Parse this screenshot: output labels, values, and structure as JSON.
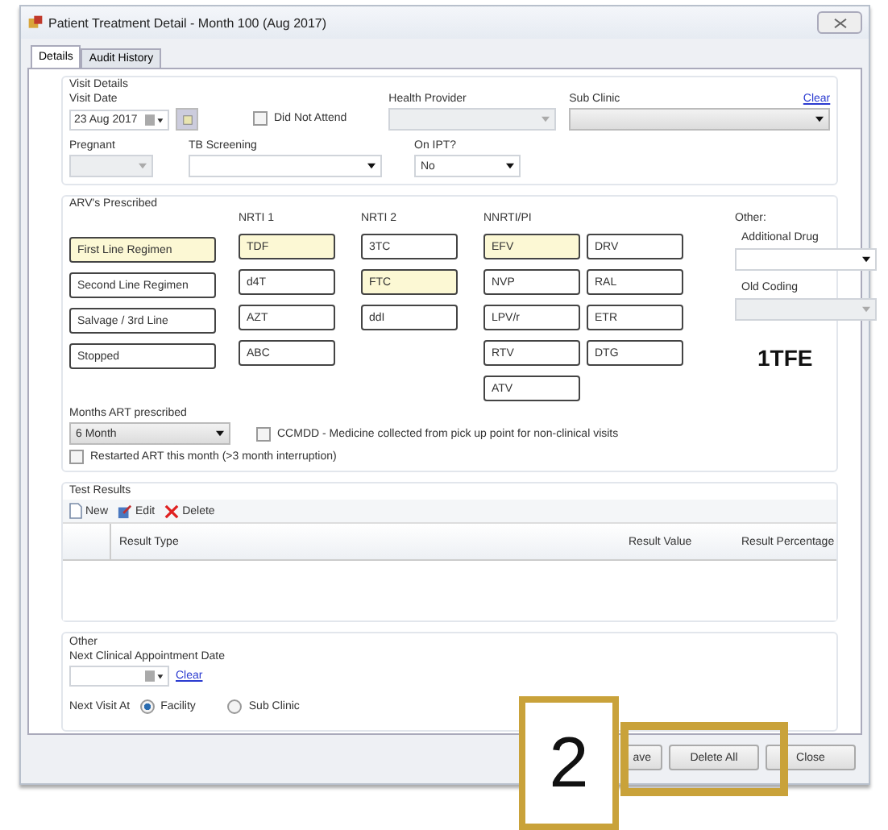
{
  "window": {
    "title": "Patient Treatment Detail - Month  100 (Aug 2017)"
  },
  "tabs": [
    {
      "label": "Details",
      "selected": true
    },
    {
      "label": "Audit History",
      "selected": false
    }
  ],
  "visit_details": {
    "legend": "Visit Details",
    "visit_date": {
      "label": "Visit Date",
      "value": "23 Aug 2017"
    },
    "did_not_attend": {
      "label": "Did Not Attend",
      "checked": false
    },
    "health_provider": {
      "label": "Health Provider",
      "disabled": true
    },
    "sub_clinic": {
      "label": "Sub Clinic",
      "clear": "Clear"
    },
    "pregnant": {
      "label": "Pregnant",
      "disabled": true
    },
    "tb_screening": {
      "label": "TB Screening"
    },
    "on_ipt": {
      "label": "On IPT?",
      "value": "No"
    }
  },
  "arvs": {
    "legend": "ARV's Prescribed",
    "regimens": [
      {
        "label": "First Line Regimen",
        "selected": true
      },
      {
        "label": "Second Line Regimen",
        "selected": false
      },
      {
        "label": "Salvage / 3rd Line",
        "selected": false
      },
      {
        "label": "Stopped",
        "selected": false
      }
    ],
    "groups": [
      {
        "heading": "NRTI 1",
        "columns": [
          [
            {
              "label": "TDF",
              "selected": true
            },
            {
              "label": "d4T",
              "selected": false
            },
            {
              "label": "AZT",
              "selected": false
            },
            {
              "label": "ABC",
              "selected": false
            }
          ]
        ]
      },
      {
        "heading": "NRTI 2",
        "columns": [
          [
            {
              "label": "3TC",
              "selected": false
            },
            {
              "label": "FTC",
              "selected": true
            },
            {
              "label": "ddI",
              "selected": false
            }
          ]
        ]
      },
      {
        "heading": "NNRTI/PI",
        "columns": [
          [
            {
              "label": "EFV",
              "selected": true
            },
            {
              "label": "NVP",
              "selected": false
            },
            {
              "label": "LPV/r",
              "selected": false
            },
            {
              "label": "RTV",
              "selected": false
            },
            {
              "label": "ATV",
              "selected": false
            }
          ],
          [
            {
              "label": "DRV",
              "selected": false
            },
            {
              "label": "RAL",
              "selected": false
            },
            {
              "label": "ETR",
              "selected": false
            },
            {
              "label": "DTG",
              "selected": false
            }
          ]
        ]
      }
    ],
    "other": {
      "heading": "Other:",
      "additional_drug": "Additional Drug",
      "old_coding": "Old Coding",
      "code": "1TFE"
    },
    "months_art": {
      "label": "Months ART prescribed",
      "value": "6 Month"
    },
    "ccmdd": {
      "label": "CCMDD - Medicine collected from pick up point for non-clinical visits",
      "checked": false
    },
    "restarted": {
      "label": "Restarted ART this month (>3 month interruption)",
      "checked": false
    }
  },
  "test_results": {
    "legend": "Test Results",
    "toolbar": [
      {
        "kind": "new",
        "label": "New"
      },
      {
        "kind": "edit",
        "label": "Edit"
      },
      {
        "kind": "delete",
        "label": "Delete"
      }
    ],
    "columns": [
      "Result Type",
      "Result Value",
      "Result Percentage"
    ]
  },
  "other": {
    "legend": "Other",
    "next_appointment": {
      "label": "Next Clinical Appointment Date",
      "clear": "Clear"
    },
    "next_visit": {
      "label": "Next Visit At",
      "options": [
        {
          "label": "Facility",
          "selected": true
        },
        {
          "label": "Sub Clinic",
          "selected": false
        }
      ]
    }
  },
  "buttons": [
    "ave",
    "Delete All",
    "Close"
  ],
  "annotation": {
    "number": "2"
  }
}
